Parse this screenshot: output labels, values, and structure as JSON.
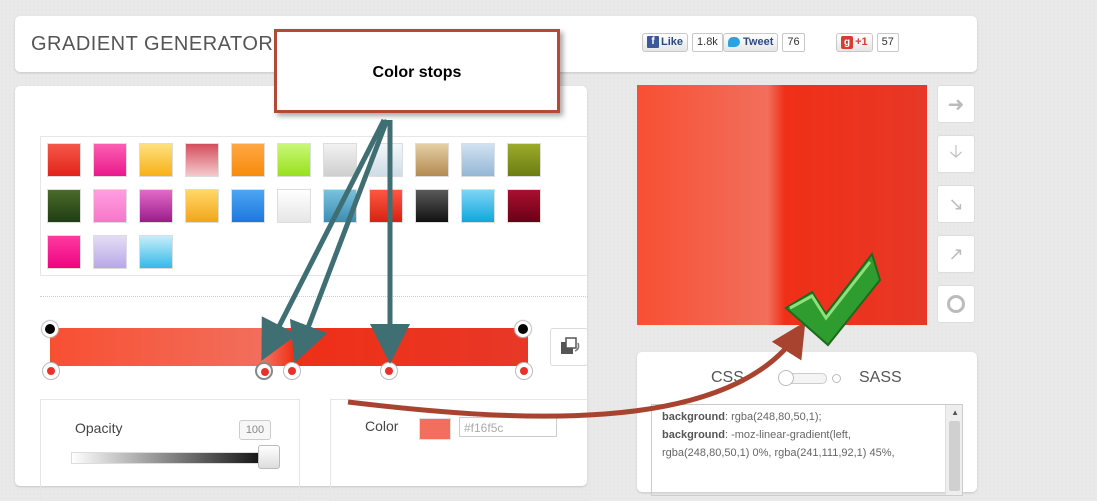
{
  "header": {
    "title": "GRADIENT GENERATOR",
    "social": {
      "facebook_label": "Like",
      "facebook_count": "1.8k",
      "twitter_label": "Tweet",
      "twitter_count": "76",
      "gplus_label": "+1",
      "gplus_count": "57"
    }
  },
  "presets": {
    "colors": [
      [
        "#f5574a",
        "#e2231a"
      ],
      [
        "#fb5fb3",
        "#ea1a8c"
      ],
      [
        "#fde17e",
        "#f8b017"
      ],
      [
        "#d44e5d",
        "#f4cacd"
      ],
      [
        "#fea742",
        "#f88b0c"
      ],
      [
        "#c8f876",
        "#98e01e"
      ],
      [
        "#f2f2f2",
        "#cecece"
      ],
      [
        "#f4f7fa",
        "#cfdce6"
      ],
      [
        "#e4cfa4",
        "#b38a51"
      ],
      [
        "#d1e2f1",
        "#95b6d6"
      ],
      [
        "#9cab2a",
        "#6c7c12"
      ],
      [
        "#4a6b2a",
        "#1f3d13"
      ],
      [
        "#ff9ee0",
        "#f776c8"
      ],
      [
        "#e36ac8",
        "#9a1c8c"
      ],
      [
        "#ffd866",
        "#f2a51b"
      ],
      [
        "#4ea5f2",
        "#1b78de"
      ],
      [
        "#ffffff",
        "#e6e6e6"
      ],
      [
        "#79c1dd",
        "#3c8eb3"
      ],
      [
        "#ff5644",
        "#d72311"
      ],
      [
        "#5a5a5a",
        "#111111"
      ],
      [
        "#7dd5f5",
        "#10a7dd"
      ],
      [
        "#aa1030",
        "#6a0015"
      ],
      [
        "#ff3aa0",
        "#ed0481"
      ],
      [
        "#e4ddf5",
        "#b8a8e6"
      ],
      [
        "#c6eef9",
        "#34b9ea"
      ]
    ]
  },
  "gradient_bar": {
    "css": "linear-gradient(to right, #f84f32 0%, #f16f5c 45%, #f02f17 51%, #e73827 100%)"
  },
  "opacity": {
    "label": "Opacity",
    "value": "100"
  },
  "color": {
    "label": "Color",
    "value": "#f16f5c"
  },
  "code": {
    "css_label": "CSS",
    "sass_label": "SASS",
    "lines": [
      {
        "prop": "background",
        "val": ": rgba(248,80,50,1);"
      },
      {
        "prop": "background",
        "val": ": -moz-linear-gradient(left,"
      },
      {
        "prop": "",
        "val": "rgba(248,80,50,1) 0%, rgba(241,111,92,1) 45%,"
      }
    ]
  },
  "annotation": {
    "callout": "Color stops"
  }
}
